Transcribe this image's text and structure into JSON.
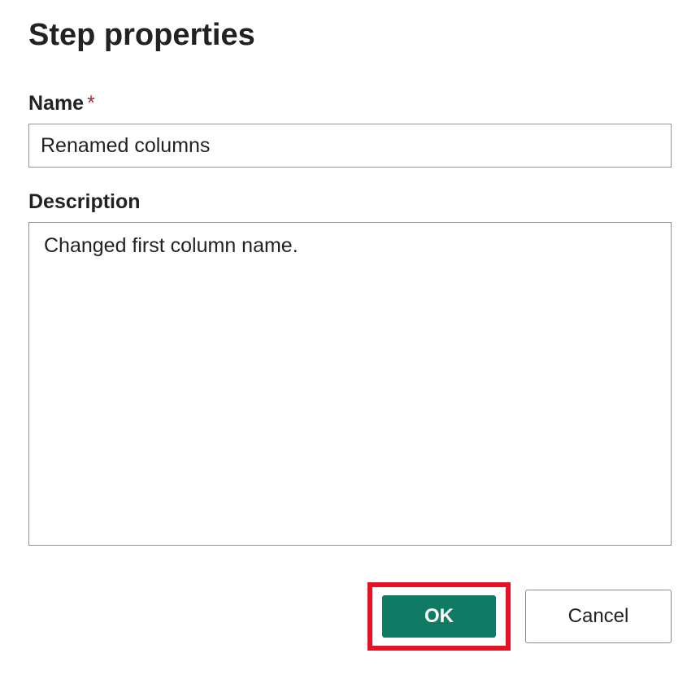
{
  "dialog": {
    "title": "Step properties"
  },
  "fields": {
    "name": {
      "label": "Name",
      "required_marker": "*",
      "value": "Renamed columns"
    },
    "description": {
      "label": "Description",
      "value": "Changed first column name."
    }
  },
  "buttons": {
    "ok": "OK",
    "cancel": "Cancel"
  }
}
